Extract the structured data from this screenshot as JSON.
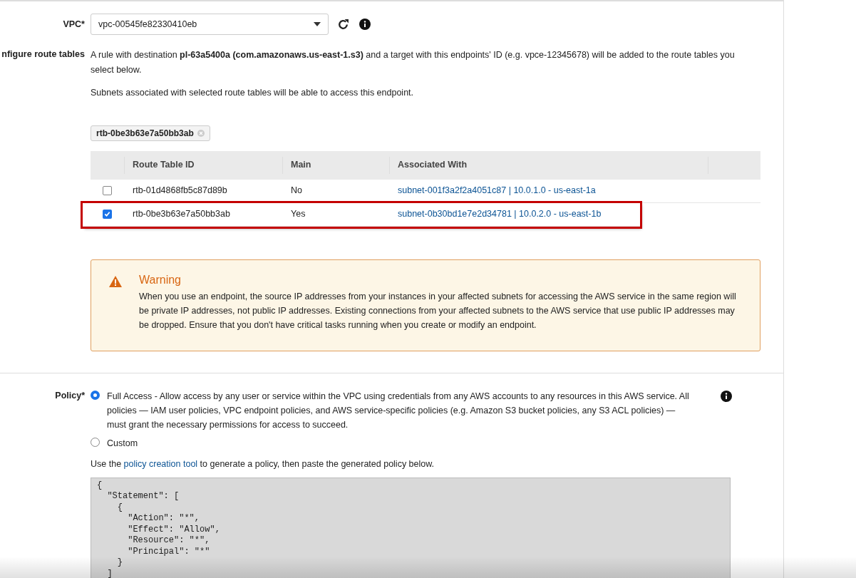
{
  "vpc": {
    "label": "VPC*",
    "value": "vpc-00545fe82330410eb"
  },
  "route_tables": {
    "label": "nfigure route tables",
    "intro": "A rule with destination **pl-63a5400a (com.amazonaws.us-east-1.s3)** and a target with this endpoints' ID (e.g. vpce-12345678) will be added to the route tables you select below.",
    "note": "Subnets associated with selected route tables will be able to access this endpoint.",
    "tokens": [
      "rtb-0be3b63e7a50bb3ab"
    ],
    "columns": [
      "Route Table ID",
      "Main",
      "Associated With"
    ],
    "rows": [
      {
        "id": "rtb-01d4868fb5c87d89b",
        "main": "No",
        "associated": "subnet-001f3a2f2a4051c87 | 10.0.1.0 - us-east-1a",
        "selected": false
      },
      {
        "id": "rtb-0be3b63e7a50bb3ab",
        "main": "Yes",
        "associated": "subnet-0b30bd1e7e2d34781 | 10.0.2.0 - us-east-1b",
        "selected": true
      }
    ]
  },
  "warning": {
    "title": "Warning",
    "text": "When you use an endpoint, the source IP addresses from your instances in your affected subnets for accessing the AWS service in the same region will be private IP addresses, not public IP addresses. Existing connections from your affected subnets to the AWS service that use public IP addresses may be dropped. Ensure that you don't have critical tasks running when you create or modify an endpoint."
  },
  "policy": {
    "label": "Policy*",
    "options": [
      {
        "label": "Full Access - Allow access by any user or service within the VPC using credentials from any AWS accounts to any resources in this AWS service. All policies — IAM user policies, VPC endpoint policies, and AWS service-specific policies (e.g. Amazon S3 bucket policies, any S3 ACL policies) — must grant the necessary permissions for access to succeed.",
        "selected": true
      },
      {
        "label": "Custom",
        "selected": false
      }
    ],
    "hint_before": "Use the",
    "hint_link": "policy creation tool",
    "hint_after": "to generate a policy, then paste the generated policy below.",
    "code": [
      "{",
      "  \"Statement\": [",
      "    {",
      "      \"Action\": \"*\",",
      "      \"Effect\": \"Allow\",",
      "      \"Resource\": \"*\",",
      "      \"Principal\": \"*\"",
      "    }",
      "  ]"
    ]
  }
}
